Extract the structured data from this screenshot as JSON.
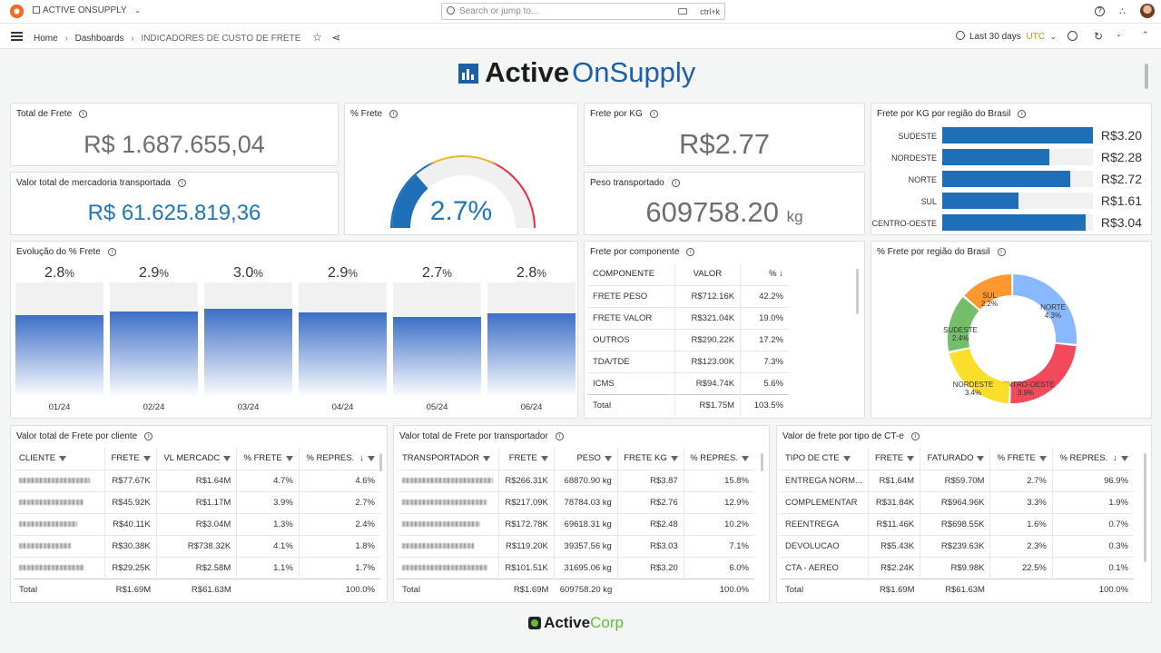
{
  "topbar": {
    "org": "ACTIVE ONSUPPLY",
    "search_placeholder": "Search or jump to...",
    "shortcut": "ctrl+k"
  },
  "breadcrumb": {
    "home": "Home",
    "dashboards": "Dashboards",
    "current": "INDICADORES DE CUSTO DE FRETE"
  },
  "timepicker": {
    "range": "Last 30 days",
    "tz": "UTC"
  },
  "brand": {
    "logo_bold": "Active",
    "logo_light": "OnSupply",
    "footer_bold": "Active",
    "footer_light": "Corp"
  },
  "colors": {
    "blue": "#1f77b4",
    "bar": "#1f6fb8"
  },
  "kpis": {
    "total_frete": {
      "title": "Total de Frete",
      "value": "R$ 1.687.655,04"
    },
    "valor_mercadoria": {
      "title": "Valor total de mercadoria transportada",
      "value": "R$ 61.625.819,36"
    },
    "pct_frete": {
      "title": "% Frete",
      "value": "2.7%",
      "gauge_fraction": 0.27
    },
    "frete_kg": {
      "title": "Frete por KG",
      "value": "R$2.77"
    },
    "peso": {
      "title": "Peso transportado",
      "value": "609758.20",
      "unit": "kg"
    }
  },
  "frete_kg_regiao": {
    "title": "Frete por KG por região do Brasil",
    "rows": [
      {
        "label": "SUDESTE",
        "display": "R$3.20",
        "value": 3.2
      },
      {
        "label": "NORDESTE",
        "display": "R$2.28",
        "value": 2.28
      },
      {
        "label": "NORTE",
        "display": "R$2.72",
        "value": 2.72
      },
      {
        "label": "SUL",
        "display": "R$1.61",
        "value": 1.61
      },
      {
        "label": "CENTRO-OESTE",
        "display": "R$3.04",
        "value": 3.04
      }
    ]
  },
  "evolucao": {
    "title": "Evolução do % Frete",
    "items": [
      {
        "month": "01/24",
        "num": "2.8",
        "pct": "%",
        "frac": 0.72
      },
      {
        "month": "02/24",
        "num": "2.9",
        "pct": "%",
        "frac": 0.75
      },
      {
        "month": "03/24",
        "num": "3.0",
        "pct": "%",
        "frac": 0.77
      },
      {
        "month": "04/24",
        "num": "2.9",
        "pct": "%",
        "frac": 0.74
      },
      {
        "month": "05/24",
        "num": "2.7",
        "pct": "%",
        "frac": 0.7
      },
      {
        "month": "06/24",
        "num": "2.8",
        "pct": "%",
        "frac": 0.73
      }
    ]
  },
  "componente": {
    "title": "Frete por componente",
    "headers": [
      "COMPONENTE",
      "VALOR",
      "%"
    ],
    "rows": [
      [
        "FRETE PESO",
        "R$712.16K",
        "42.2%"
      ],
      [
        "FRETE VALOR",
        "R$321.04K",
        "19.0%"
      ],
      [
        "OUTROS",
        "R$290.22K",
        "17.2%"
      ],
      [
        "TDA/TDE",
        "R$123.00K",
        "7.3%"
      ],
      [
        "ICMS",
        "R$94.74K",
        "5.6%"
      ]
    ],
    "total": [
      "Total",
      "R$1.75M",
      "103.5%"
    ]
  },
  "pct_regiao": {
    "title": "% Frete por região do Brasil",
    "slices": [
      {
        "label": "NORTE",
        "display": "4.3%",
        "value": 4.3,
        "color": "#8ab8ff"
      },
      {
        "label": "CENTRO-OESTE",
        "display": "3.9%",
        "value": 3.9,
        "color": "#f2495c"
      },
      {
        "label": "NORDESTE",
        "display": "3.4%",
        "value": 3.4,
        "color": "#fade2a"
      },
      {
        "label": "SUDESTE",
        "display": "2.4%",
        "value": 2.4,
        "color": "#73bf69"
      },
      {
        "label": "SUL",
        "display": "2.2%",
        "value": 2.2,
        "color": "#ff9830"
      }
    ]
  },
  "por_cliente": {
    "title": "Valor total de Frete por cliente",
    "headers": [
      "CLIENTE",
      "FRETE",
      "VL MERCADC",
      "% FRETE",
      "% REPRES."
    ],
    "rows": [
      [
        "",
        "R$77.67K",
        "R$1.64M",
        "4.7%",
        "4.6%"
      ],
      [
        "",
        "R$45.92K",
        "R$1.17M",
        "3.9%",
        "2.7%"
      ],
      [
        "",
        "R$40.11K",
        "R$3.04M",
        "1.3%",
        "2.4%"
      ],
      [
        "",
        "R$30.38K",
        "R$738.32K",
        "4.1%",
        "1.8%"
      ],
      [
        "",
        "R$29.25K",
        "R$2.58M",
        "1.1%",
        "1.7%"
      ]
    ],
    "total": [
      "Total",
      "R$1.69M",
      "R$61.63M",
      "",
      "100.0%"
    ]
  },
  "por_transportador": {
    "title": "Valor total de Frete por transportador",
    "headers": [
      "TRANSPORTADOR",
      "FRETE",
      "PESO",
      "FRETE KG",
      "% REPRES."
    ],
    "rows": [
      [
        "",
        "R$266.31K",
        "68870.90 kg",
        "R$3.87",
        "15.8%"
      ],
      [
        "",
        "R$217.09K",
        "78784.03 kg",
        "R$2.76",
        "12.9%"
      ],
      [
        "",
        "R$172.78K",
        "69618.31 kg",
        "R$2.48",
        "10.2%"
      ],
      [
        "",
        "R$119.20K",
        "39357.56 kg",
        "R$3.03",
        "7.1%"
      ],
      [
        "",
        "R$101.51K",
        "31695.06 kg",
        "R$3.20",
        "6.0%"
      ]
    ],
    "total": [
      "Total",
      "R$1.69M",
      "609758.20 kg",
      "",
      "100.0%"
    ]
  },
  "por_cte": {
    "title": "Valor de frete por tipo de CT-e",
    "headers": [
      "TIPO DE CTE",
      "FRETE",
      "FATURADO",
      "% FRETE",
      "% REPRES."
    ],
    "rows": [
      [
        "ENTREGA NORM...",
        "R$1.64M",
        "R$59.70M",
        "2.7%",
        "96.9%"
      ],
      [
        "COMPLEMENTAR",
        "R$31.84K",
        "R$964.96K",
        "3.3%",
        "1.9%"
      ],
      [
        "REENTREGA",
        "R$11.46K",
        "R$698.55K",
        "1.6%",
        "0.7%"
      ],
      [
        "DEVOLUCAO",
        "R$5.43K",
        "R$239.63K",
        "2.3%",
        "0.3%"
      ],
      [
        "CTA - AEREO",
        "R$2.24K",
        "R$9.98K",
        "22.5%",
        "0.1%"
      ]
    ],
    "total": [
      "Total",
      "R$1.69M",
      "R$61.63M",
      "",
      "100.0%"
    ]
  }
}
